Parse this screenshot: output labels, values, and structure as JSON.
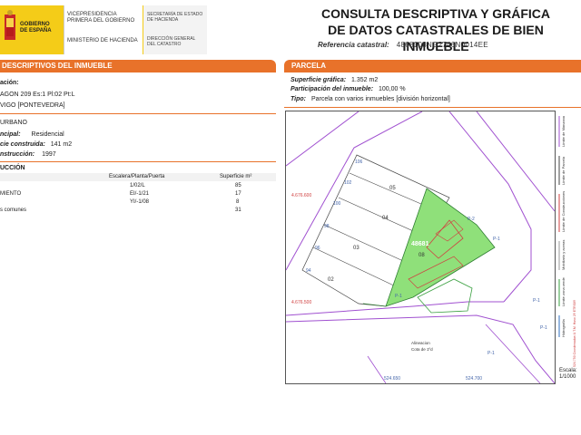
{
  "header": {
    "gov_name": "GOBIERNO DE ESPAÑA",
    "vice_title": "VICEPRESIDENCIA PRIMERA DEL GOBIERNO",
    "ministry": "MINISTERIO DE HACIENDA",
    "secretaria": "SECRETARÍA DE ESTADO DE HACIENDA",
    "direccion": "DIRECCIÓN GENERAL DEL CATASTRO",
    "title_line1": "CONSULTA DESCRIPTIVA Y GRÁFICA",
    "title_line2": "DE DATOS CATASTRALES DE BIEN INMUEBLE",
    "ref_label": "Referencia catastral:",
    "ref_value": "4868108NG2746N0014EE"
  },
  "left": {
    "bar_title": "DESCRIPTIVOS DEL INMUEBLE",
    "location_label": "ación:",
    "address_line1": "AGON 209 Es:1 Pl:02 Pt:L",
    "address_line2": "VIGO [PONTEVEDRA]",
    "class_value": "URBANO",
    "use_label": "ncipal:",
    "use_value": "Residencial",
    "area_label": "cie construida:",
    "area_value": "141 m2",
    "year_label": "nstrucción:",
    "year_value": "1997",
    "construction_heading": "UCCIÓN",
    "table": {
      "col2": "Escalera/Planta/Puerta",
      "col3": "Superficie m²",
      "rows": [
        {
          "c1": "",
          "c2": "1/02/L",
          "c3": "85"
        },
        {
          "c1": "MIENTO",
          "c2": "EI/-1/21",
          "c3": "17"
        },
        {
          "c1": "",
          "c2": "YI/-1/08",
          "c3": "8"
        },
        {
          "c1": "s comunes",
          "c2": "",
          "c3": "31"
        }
      ]
    }
  },
  "right": {
    "bar_title": "PARCELA",
    "surface_label": "Superficie gráfica:",
    "surface_value": "1.352 m2",
    "share_label": "Participación del inmueble:",
    "share_value": "100,00 %",
    "type_label": "Tipo:",
    "type_value": "Parcela con varios inmuebles [división horizontal]"
  },
  "map": {
    "parcel_id": "48681",
    "lots": [
      "05",
      "04",
      "03",
      "02",
      "08"
    ],
    "street_numbers": [
      "106",
      "102",
      "100",
      "98",
      "96",
      "94"
    ],
    "edge_labels": [
      "P-1",
      "P-1",
      "P-1",
      "P-2",
      "P-1",
      "P-1"
    ],
    "coord_y1": "4.676.600",
    "coord_y2": "4.676.500",
    "coord_x1": "524.650",
    "coord_x2": "524.700",
    "note_line1": "Alineacion",
    "note_line2": "Cota de 1ºd"
  },
  "legend": {
    "items": [
      "Límite de Manzana",
      "Límite de Parcela",
      "Límite de Construcciones",
      "Mobiliario y aceras",
      "Límite zona verde",
      "Hidrografía"
    ],
    "footer": "524.750 Coordenadas U.T.M. Huso 29 ETRS89",
    "scale_label": "Escala:",
    "scale_value": "1/1000"
  },
  "colors": {
    "accent_orange": "#e8722a",
    "gov_yellow": "#f4cc18",
    "parcel_green": "#8fe07a",
    "boundary_purple": "#a050d0",
    "construction_red": "#d04040"
  }
}
